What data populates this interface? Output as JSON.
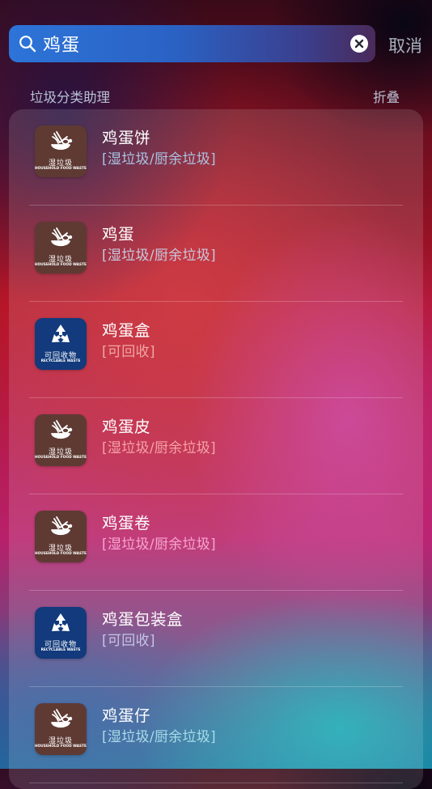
{
  "search": {
    "query": "鸡蛋",
    "cancel_label": "取消"
  },
  "section": {
    "title": "垃圾分类助理",
    "collapse_label": "折叠"
  },
  "icons": {
    "wet": {
      "label": "湿垃圾",
      "sub": "HOUSEHOLD FOOD WASTE",
      "color": "#5e3a33",
      "icon": "food-waste-icon"
    },
    "recyclable": {
      "label": "可回收物",
      "sub": "RECYCLABLE WASTE",
      "color": "#123a7c",
      "icon": "recycle-icon"
    }
  },
  "results": [
    {
      "name": "鸡蛋饼",
      "category": "[湿垃圾/厨余垃圾]",
      "type": "wet",
      "category_color": "#a9c4e4"
    },
    {
      "name": "鸡蛋",
      "category": "[湿垃圾/厨余垃圾]",
      "type": "wet",
      "category_color": "#c7c9e0"
    },
    {
      "name": "鸡蛋盒",
      "category": "[可回收]",
      "type": "recyclable",
      "category_color": "#f0a6a6"
    },
    {
      "name": "鸡蛋皮",
      "category": "[湿垃圾/厨余垃圾]",
      "type": "wet",
      "category_color": "#f6a2a8"
    },
    {
      "name": "鸡蛋卷",
      "category": "[湿垃圾/厨余垃圾]",
      "type": "wet",
      "category_color": "#f9a6cf"
    },
    {
      "name": "鸡蛋包装盒",
      "category": "[可回收]",
      "type": "recyclable",
      "category_color": "#c3c6e6"
    },
    {
      "name": "鸡蛋仔",
      "category": "[湿垃圾/厨余垃圾]",
      "type": "wet",
      "category_color": "#a9dde8"
    }
  ]
}
